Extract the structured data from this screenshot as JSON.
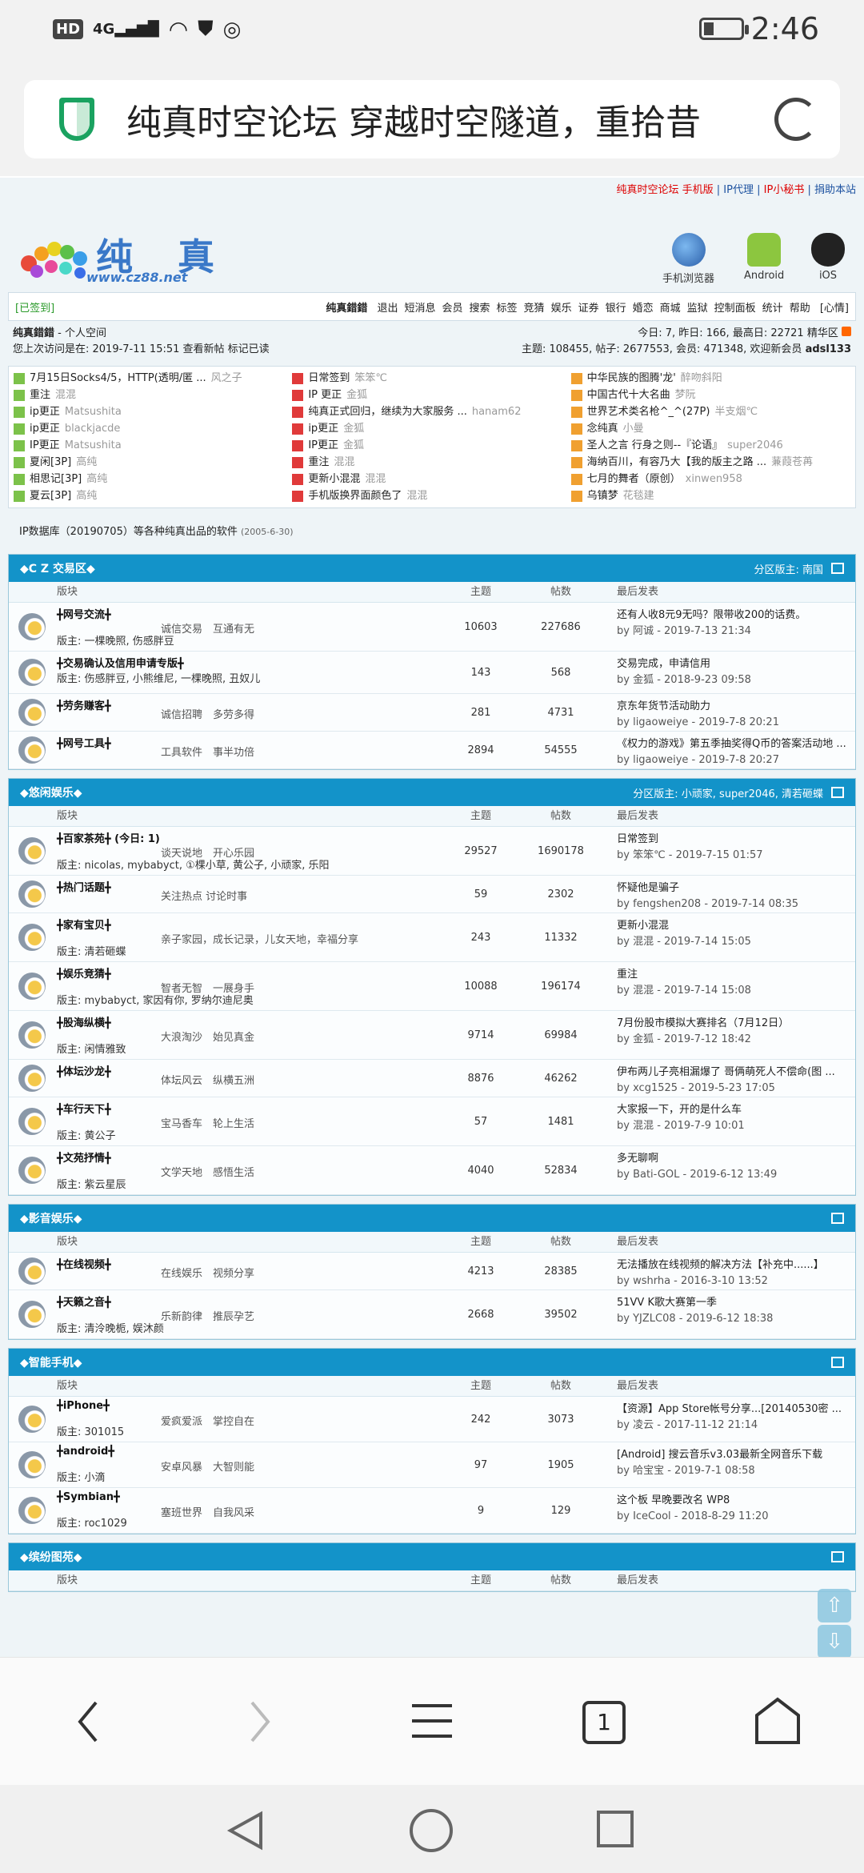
{
  "status": {
    "time": "2:46",
    "hd": "HD",
    "net": "4G"
  },
  "url": {
    "title": "纯真时空论坛 穿越时空隧道，重拾昔"
  },
  "toplinks": {
    "a": "纯真时空论坛 手机版",
    "b": "IP代理",
    "c": "IP小秘书",
    "d": "捐助本站"
  },
  "logo": {
    "cn": "纯 真",
    "www": "www.cz88.net"
  },
  "apps": [
    {
      "label": "手机浏览器"
    },
    {
      "label": "Android"
    },
    {
      "label": "iOS"
    }
  ],
  "menubar": {
    "signed": "[已签到]",
    "user": "纯真錯錯",
    "items": [
      "退出",
      "短消息",
      "会员",
      "搜索",
      "标签",
      "竞猜",
      "娱乐",
      "证券",
      "银行",
      "婚恋",
      "商城",
      "监狱",
      "控制面板",
      "统计",
      "帮助"
    ],
    "mood": "[心情]"
  },
  "userinfo": {
    "name": "纯真錯錯",
    "space": "- 个人空间",
    "last": "您上次访问是在: 2019-7-11 15:51",
    "links": "查看新帖 标记已读",
    "today": "今日: 7, 昨日: 166, 最高日: 22721",
    "digest": "精华区",
    "stats": "主题: 108455, 帖子: 2677553, 会员: 471348, 欢迎新会员",
    "newuser": "adsl133"
  },
  "news": [
    [
      {
        "t": "7月15日Socks4/5，HTTP(透明/匿 ...",
        "a": "风之子"
      },
      {
        "t": "重注",
        "a": "混混"
      },
      {
        "t": "ip更正",
        "a": "Matsushita"
      },
      {
        "t": "ip更正",
        "a": "blackjacde"
      },
      {
        "t": "IP更正",
        "a": "Matsushita"
      },
      {
        "t": "夏闲[3P]",
        "a": "高纯"
      },
      {
        "t": "相思记[3P]",
        "a": "高纯"
      },
      {
        "t": "夏云[3P]",
        "a": "高纯"
      }
    ],
    [
      {
        "t": "日常签到",
        "a": "笨笨℃"
      },
      {
        "t": "IP 更正",
        "a": "金狐"
      },
      {
        "t": "纯真正式回归，继续为大家服务 ...",
        "a": "hanam62"
      },
      {
        "t": "ip更正",
        "a": "金狐"
      },
      {
        "t": "IP更正",
        "a": "金狐"
      },
      {
        "t": "重注",
        "a": "混混"
      },
      {
        "t": "更新小混混",
        "a": "混混"
      },
      {
        "t": "手机版换界面颜色了",
        "a": "混混"
      }
    ],
    [
      {
        "t": "中华民族的图腾'龙'",
        "a": "醉吻斜阳"
      },
      {
        "t": "中国古代十大名曲",
        "a": "梦阮"
      },
      {
        "t": "世界艺术类名枪^_^(27P)",
        "a": "半支烟℃"
      },
      {
        "t": "念纯真",
        "a": "小曼"
      },
      {
        "t": "圣人之言 行身之则--『论语』",
        "a": "super2046"
      },
      {
        "t": "海纳百川，有容乃大【我的版主之路 ...",
        "a": "蒹葭苍苒"
      },
      {
        "t": "七月的舞者（原创）",
        "a": "xinwen958"
      },
      {
        "t": "乌镇梦",
        "a": "花毯建"
      }
    ]
  ],
  "ipline": {
    "text": "IP数据库（20190705）等各种纯真出品的软件",
    "date": "(2005-6-30)"
  },
  "cols": {
    "f": "版块",
    "t": "主题",
    "p": "帖数",
    "l": "最后发表"
  },
  "sections": [
    {
      "title": "◆C Z 交易区◆",
      "mods": "分区版主: 南国",
      "rows": [
        {
          "n": "╋网号交流╋",
          "tags": "诚信交易　互通有无",
          "m": "版主: 一棵晚照, 伤感胖豆",
          "t": "10603",
          "p": "227686",
          "l1": "还有人收8元9无吗？限带收200的话费。",
          "l2": "by 阿诚 - 2019-7-13 21:34"
        },
        {
          "n": "╋交易确认及信用申请专版╋",
          "tags": "",
          "m": "版主: 伤感胖豆, 小熊维尼, 一棵晚照, 丑奴儿",
          "t": "143",
          "p": "568",
          "l1": "交易完成，申请信用",
          "l2": "by 金狐 - 2018-9-23 09:58"
        },
        {
          "n": "╋劳务赚客╋",
          "tags": "诚信招聘　多劳多得",
          "m": "",
          "t": "281",
          "p": "4731",
          "l1": "京东年货节活动助力",
          "l2": "by ligaoweiye - 2019-7-8 20:21"
        },
        {
          "n": "╋网号工具╋",
          "tags": "工具软件　事半功倍",
          "m": "",
          "t": "2894",
          "p": "54555",
          "l1": "《权力的游戏》第五季抽奖得Q币的答案活动地 ...",
          "l2": "by ligaoweiye - 2019-7-8 20:27"
        }
      ]
    },
    {
      "title": "◆悠闲娱乐◆",
      "mods": "分区版主: 小顽家, super2046, 清若砸蝶",
      "rows": [
        {
          "n": "╋百家茶苑╋ (今日: 1)",
          "tags": "谈天说地　开心乐园",
          "m": "版主: nicolas, mybabyct, ①棵小草, 黄公子, 小顽家, 乐阳",
          "t": "29527",
          "p": "1690178",
          "l1": "日常签到",
          "l2": "by 笨笨℃ - 2019-7-15 01:57"
        },
        {
          "n": "╋热门话题╋",
          "tags": "关注热点 讨论时事",
          "m": "",
          "t": "59",
          "p": "2302",
          "l1": "怀疑他是骗子",
          "l2": "by fengshen208 - 2019-7-14 08:35"
        },
        {
          "n": "╋家有宝贝╋",
          "tags": "亲子家园，成长记录，儿女天地，幸福分享",
          "m": "版主: 清若砸蝶",
          "t": "243",
          "p": "11332",
          "l1": "更新小混混",
          "l2": "by 混混 - 2019-7-14 15:05"
        },
        {
          "n": "╋娱乐竞猜╋",
          "tags": "智者无智　一展身手",
          "m": "版主: mybabyct, 家因有你, 罗纳尔迪尼奥",
          "t": "10088",
          "p": "196174",
          "l1": "重注",
          "l2": "by 混混 - 2019-7-14 15:08"
        },
        {
          "n": "╋股海纵横╋",
          "tags": "大浪淘沙　始见真金",
          "m": "版主: 闲情雅致",
          "t": "9714",
          "p": "69984",
          "l1": "7月份股市模拟大赛排名（7月12日）",
          "l2": "by 金狐 - 2019-7-12 18:42"
        },
        {
          "n": "╋体坛沙龙╋",
          "tags": "体坛风云　纵横五洲",
          "m": "",
          "t": "8876",
          "p": "46262",
          "l1": "伊布两儿子亮相漏爆了 哥俩萌死人不偿命(图 ...",
          "l2": "by xcg1525 - 2019-5-23 17:05"
        },
        {
          "n": "╋车行天下╋",
          "tags": "宝马香车　轮上生活",
          "m": "版主: 黄公子",
          "t": "57",
          "p": "1481",
          "l1": "大家报一下，开的是什么车",
          "l2": "by 混混 - 2019-7-9 10:01"
        },
        {
          "n": "╋文苑抒情╋",
          "tags": "文学天地　感悟生活",
          "m": "版主: 紫云星辰",
          "t": "4040",
          "p": "52834",
          "l1": "多无聊啊",
          "l2": "by Bati-GOL - 2019-6-12 13:49"
        }
      ]
    },
    {
      "title": "◆影音娱乐◆",
      "mods": "",
      "rows": [
        {
          "n": "╋在线视频╋",
          "tags": "在线娱乐　视频分享",
          "m": "",
          "t": "4213",
          "p": "28385",
          "l1": "无法播放在线视频的解决方法【补充中......】",
          "l2": "by wshrha - 2016-3-10 13:52"
        },
        {
          "n": "╋天籁之音╋",
          "tags": "乐新韵律　推辰孕艺",
          "m": "版主: 清泠晚栀, 娱沐颜",
          "t": "2668",
          "p": "39502",
          "l1": "51VV K歌大赛第一季",
          "l2": "by YJZLC08 - 2019-6-12 18:38"
        }
      ]
    },
    {
      "title": "◆智能手机◆",
      "mods": "",
      "rows": [
        {
          "n": "╋iPhone╋",
          "tags": "爱疯爱派　掌控自在",
          "m": "版主: 301015",
          "t": "242",
          "p": "3073",
          "l1": "【资源】App Store帐号分享...[20140530密 ...",
          "l2": "by 凌云 - 2017-11-12 21:14"
        },
        {
          "n": "╋android╋",
          "tags": "安卓风暴　大智则能",
          "m": "版主: 小滴",
          "t": "97",
          "p": "1905",
          "l1": "[Android] 搜云音乐v3.03最新全网音乐下载",
          "l2": "by 哈宝宝 - 2019-7-1 08:58"
        },
        {
          "n": "╋Symbian╋",
          "tags": "塞班世界　自我风采",
          "m": "版主: roc1029",
          "t": "9",
          "p": "129",
          "l1": "这个板 早晚要改名 WP8",
          "l2": "by IceCool - 2018-8-29 11:20"
        }
      ]
    },
    {
      "title": "◆缤纷图苑◆",
      "mods": "",
      "rows": []
    }
  ]
}
